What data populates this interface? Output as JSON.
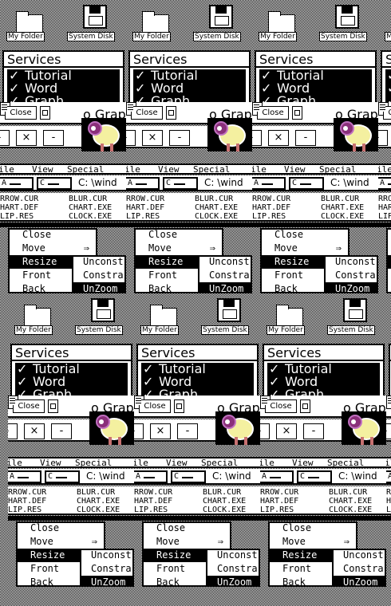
{
  "desktop": {
    "icons": [
      {
        "label": "My Folder",
        "icon": "folder-icon"
      },
      {
        "label": "System Disk",
        "icon": "floppy-disk-icon"
      }
    ]
  },
  "services": {
    "title": "Services",
    "items": [
      "Tutorial",
      "Word",
      "Graph"
    ],
    "check": "✓"
  },
  "graph_window": {
    "close_label": "Close",
    "title": "o Grap",
    "controls": [
      "-",
      "×",
      "-"
    ]
  },
  "menubar": {
    "items": [
      "ile",
      "View",
      "Special"
    ]
  },
  "pathbar": {
    "drives": [
      "A",
      "C"
    ],
    "path": "C: \\wind"
  },
  "files": {
    "col1": [
      "RROW.CUR",
      "HART.DEF",
      "LIP.RES"
    ],
    "col2": [
      "BLUR.CUR",
      "CHART.EXE",
      "CLOCK.EXE"
    ]
  },
  "window_menu": {
    "items": [
      "Close",
      "Move",
      "Resize",
      "Front",
      "Back"
    ],
    "selected": "Resize",
    "move_arrow": "⇒",
    "back_arrow": "→"
  },
  "submenu": {
    "items": [
      "Unconst",
      "Constra",
      "UnZoom"
    ],
    "selected": "UnZoom"
  }
}
